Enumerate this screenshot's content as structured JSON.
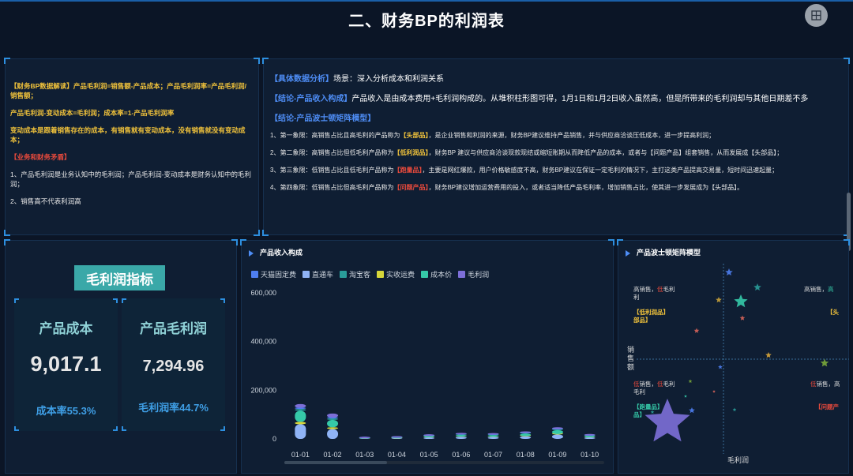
{
  "title": "二、财务BP的利润表",
  "corner_button": {
    "icon": "grid-icon"
  },
  "left_panel": {
    "p1_label": "【财务BP数据解读】",
    "p1_text": "产品毛利润=销售额-产品成本；产品毛利润率=产品毛利润/销售额；",
    "p2_text": "产品毛利润-变动成本=毛利润；成本率=1-产品毛利润率",
    "p3_text": "变动成本是跟着销售存在的成本，有销售就有变动成本，没有销售就没有变动成本；",
    "p4_label": "【业务和财务矛盾】",
    "p5_text": "1、产品毛利润是业务认知中的毛利润；产品毛利润-变动成本是财务认知中的毛利润；",
    "p6_text": "2、销售高不代表利润高"
  },
  "right_panel": {
    "r1_label": "【具体数据分析】",
    "r1_text": "场景：深入分析成本和利润关系",
    "r2_label": "【结论-产品收入构成】",
    "r2_text": "产品收入是由成本费用+毛利润构成的。从堆积柱形图可得，1月1日和1月2日收入虽然高，但是所带来的毛利润却与其他日期差不多",
    "r3_label": "【结论-产品波士顿矩阵模型】",
    "q1_a": "1、第一象限：高销售占比且高毛利的产品称为",
    "q1_tag": "【头部品】",
    "q1_b": "，是企业销售和利润的来源，财务BP建议维持产品销售，并与供应商洽谈压低成本，进一步提高利润；",
    "q2_a": "2、第二象限：高销售占比但低毛利产品称为",
    "q2_tag": "【低利润品】",
    "q2_b": "，财务BP 建议与供应商洽谈现款现结或缩短账期从而降低产品的成本，或者与【问题产品】组套销售，从而发展成【头部品】；",
    "q3_a": "3、第三象限：低销售占比且低毛利产品称为",
    "q3_tag": "【跑量品】",
    "q3_b": "，主要是网红爆款，用户价格敏感度不高，财务BP建议在保证一定毛利的情况下，主打这类产品提高交易量，短时间迅速起量；",
    "q4_a": "4、第四象限：低销售占比但高毛利产品称为",
    "q4_tag": "【问题产品】",
    "q4_b": "，财务BP建议增加运营费用的投入，或者适当降低产品毛利率，增加销售占比，使其进一步发展成为【头部品】。"
  },
  "kpi": {
    "title": "毛利润指标",
    "cost_name": "产品成本",
    "cost_value": "9,017.1",
    "cost_rate": "成本率55.3%",
    "profit_name": "产品毛利润",
    "profit_value": "7,294.96",
    "profit_rate": "毛利润率44.7%"
  },
  "income_chart": {
    "title": "产品收入构成",
    "legend": [
      {
        "name": "天猫固定费",
        "color": "#4e7ef0"
      },
      {
        "name": "直通车",
        "color": "#8fb3f5"
      },
      {
        "name": "淘宝客",
        "color": "#2a9d9a"
      },
      {
        "name": "实收运费",
        "color": "#d6d63a"
      },
      {
        "name": "成本价",
        "color": "#35c9a8"
      },
      {
        "name": "毛利润",
        "color": "#7d6fd8"
      }
    ],
    "yticks": [
      "600,000",
      "400,000",
      "200,000",
      "0"
    ]
  },
  "matrix_chart": {
    "title": "产品波士顿矩阵模型",
    "ylabel": "销售额",
    "xlabel": "毛利润",
    "q2_label_a": "高销售，",
    "q2_label_b": "低",
    "q2_label_c": "毛利",
    "q2_tag": "【低利润品】",
    "q1_label_a": "高销售，",
    "q1_label_b": "高",
    "q1_tag": "【头",
    "q3_label_a": "低",
    "q3_label_b": "销售，",
    "q3_label_c": "低",
    "q3_label_d": "毛利",
    "q3_tag": "【跑量品】",
    "q4_label_a": "低",
    "q4_label_b": "销售，高",
    "q4_tag": "【问题产"
  },
  "chart_data": {
    "type": "bar",
    "stacked": true,
    "categories": [
      "01-01",
      "01-02",
      "01-03",
      "01-04",
      "01-05",
      "01-06",
      "01-07",
      "01-08",
      "01-09",
      "01-10"
    ],
    "series": [
      {
        "name": "天猫固定费",
        "values": [
          5000,
          4000,
          300,
          500,
          800,
          900,
          1000,
          1200,
          1500,
          700
        ]
      },
      {
        "name": "直通车",
        "values": [
          60000,
          40000,
          1000,
          2000,
          6000,
          9000,
          8000,
          11000,
          18000,
          6000
        ]
      },
      {
        "name": "淘宝客",
        "values": [
          8000,
          6000,
          300,
          500,
          1000,
          1500,
          1500,
          2000,
          3000,
          1200
        ]
      },
      {
        "name": "实收运费",
        "values": [
          10000,
          8000,
          200,
          400,
          700,
          900,
          900,
          1200,
          1800,
          700
        ]
      },
      {
        "name": "成本价",
        "values": [
          45000,
          30000,
          800,
          1500,
          4000,
          6000,
          6000,
          9000,
          16000,
          5000
        ]
      },
      {
        "name": "毛利润",
        "values": [
          15000,
          16000,
          1500,
          2500,
          4000,
          4500,
          5000,
          6000,
          7500,
          4500
        ]
      }
    ],
    "ylim": [
      0,
      600000
    ]
  }
}
